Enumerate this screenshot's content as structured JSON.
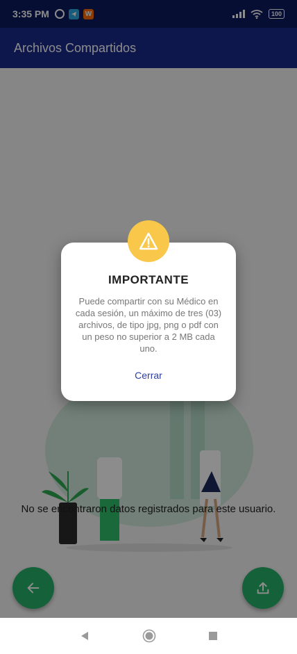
{
  "status_bar": {
    "time": "3:35 PM",
    "battery": "100",
    "icons": [
      "alarm-icon",
      "telegram-icon",
      "w-app-icon",
      "signal-icon",
      "wifi-icon",
      "battery-icon"
    ]
  },
  "app_bar": {
    "title": "Archivos Compartidos"
  },
  "main": {
    "empty_message": "No se encontraron  datos registrados para este usuario."
  },
  "dialog": {
    "title": "IMPORTANTE",
    "message": "Puede compartir con su Médico en cada sesión, un máximo de tres (03) archivos, de tipo jpg, png o pdf con un peso no superior a 2 MB cada uno.",
    "close_label": "Cerrar",
    "icon": "warning-icon"
  },
  "fabs": {
    "back_icon": "arrow-left-icon",
    "upload_icon": "upload-icon"
  },
  "nav": {
    "icons": [
      "back-triangle-icon",
      "home-circle-icon",
      "recents-square-icon"
    ]
  },
  "colors": {
    "status_bar": "#0d1b5e",
    "app_bar": "#1a2a8a",
    "accent_green": "#27b36a",
    "warning": "#f9c84a",
    "link": "#2a3ea8"
  }
}
